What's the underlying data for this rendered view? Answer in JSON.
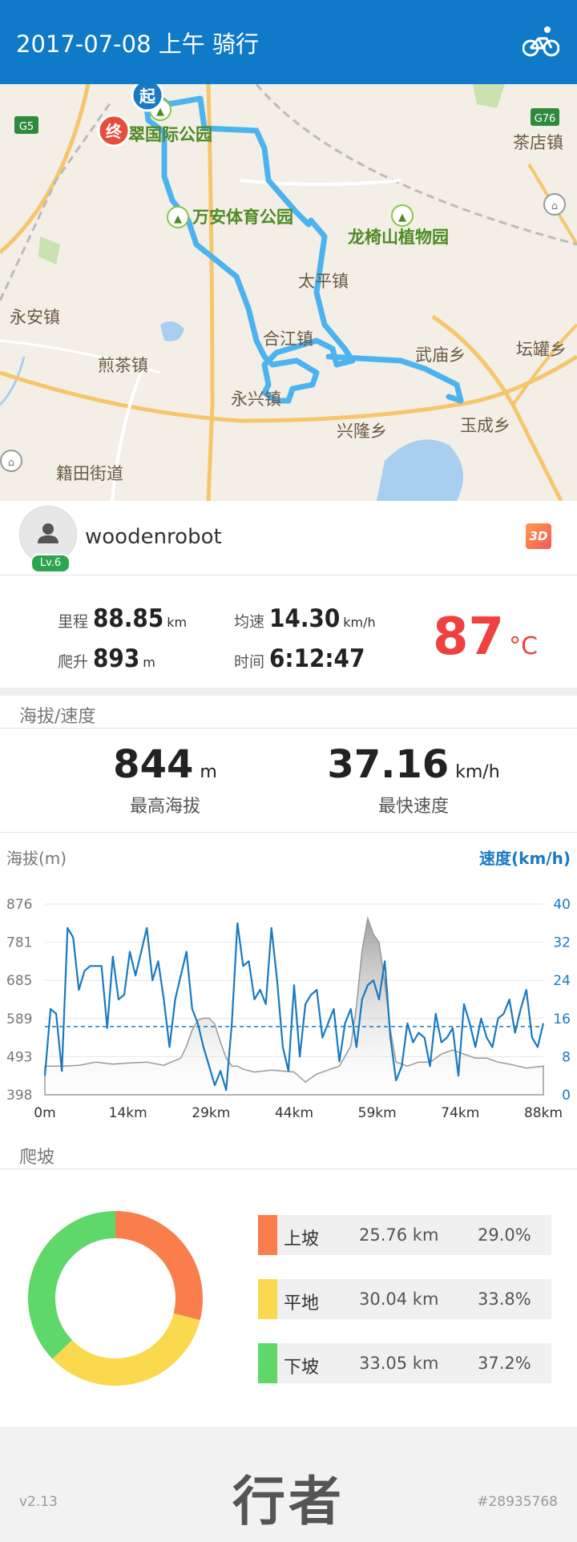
{
  "header": {
    "title": "2017-07-08 上午 骑行",
    "icon": "bicycle-icon"
  },
  "map": {
    "route_color": "#4bb3f0",
    "start_marker": "起",
    "end_marker": "终",
    "road_shields": [
      "G5",
      "G76"
    ],
    "labels": [
      {
        "id": "park1",
        "text": "翠国际公园",
        "style": "green"
      },
      {
        "id": "park2",
        "text": "万安体育公园",
        "style": "green"
      },
      {
        "id": "park3",
        "text": "龙椅山植物园",
        "style": "green"
      },
      {
        "id": "t1",
        "text": "茶店镇",
        "style": "town"
      },
      {
        "id": "t2",
        "text": "太平镇",
        "style": "town"
      },
      {
        "id": "t3",
        "text": "永安镇",
        "style": "town"
      },
      {
        "id": "t4",
        "text": "合江镇",
        "style": "town"
      },
      {
        "id": "t5",
        "text": "煎茶镇",
        "style": "town"
      },
      {
        "id": "t6",
        "text": "武庙乡",
        "style": "town"
      },
      {
        "id": "t7",
        "text": "坛罐乡",
        "style": "town"
      },
      {
        "id": "t8",
        "text": "永兴镇",
        "style": "town"
      },
      {
        "id": "t9",
        "text": "兴隆乡",
        "style": "town"
      },
      {
        "id": "t10",
        "text": "玉成乡",
        "style": "town"
      },
      {
        "id": "t11",
        "text": "籍田街道",
        "style": "town"
      }
    ]
  },
  "user": {
    "name": "woodenrobot",
    "level": "Lv.6",
    "badge_3d": "3D"
  },
  "stats": {
    "distance": {
      "label": "里程",
      "value": "88.85",
      "unit": "km"
    },
    "avg_speed": {
      "label": "均速",
      "value": "14.30",
      "unit": "km/h"
    },
    "climb": {
      "label": "爬升",
      "value": "893",
      "unit": "m"
    },
    "time": {
      "label": "时间",
      "value": "6:12:47"
    },
    "temperature": {
      "value": "87",
      "unit": "°C",
      "color": "#f04141"
    }
  },
  "altitude_speed": {
    "section_title": "海拔/速度",
    "max_altitude": {
      "value": "844",
      "unit": "m",
      "label": "最高海拔"
    },
    "max_speed": {
      "value": "37.16",
      "unit": "km/h",
      "label": "最快速度"
    }
  },
  "chart_data": {
    "type": "line",
    "left_axis_label": "海拔(m)",
    "right_axis_label": "速度(km/h)",
    "y_left_ticks": [
      "876",
      "781",
      "685",
      "589",
      "493",
      "398"
    ],
    "y_right_ticks": [
      "40",
      "32",
      "24",
      "16",
      "8",
      "0"
    ],
    "x_ticks": [
      "0m",
      "14km",
      "29km",
      "44km",
      "59km",
      "74km",
      "88km"
    ],
    "ylim_left": [
      398,
      876
    ],
    "ylim_right": [
      0,
      40
    ],
    "xlim": [
      0,
      88
    ],
    "avg_speed_line": 14.3,
    "series": [
      {
        "name": "海拔(m)",
        "color": "#999999",
        "x": [
          0,
          3,
          6,
          9,
          12,
          15,
          18,
          21,
          24,
          25,
          26,
          27,
          28,
          29,
          30,
          31,
          32,
          33,
          34,
          35,
          37,
          40,
          44,
          46,
          48,
          50,
          52,
          54,
          55,
          56,
          57,
          58,
          59,
          60,
          61,
          62,
          64,
          66,
          68,
          70,
          72,
          74,
          76,
          78,
          80,
          82,
          85,
          88
        ],
        "values": [
          470,
          470,
          472,
          480,
          475,
          478,
          480,
          472,
          490,
          520,
          560,
          585,
          590,
          590,
          575,
          530,
          490,
          470,
          470,
          462,
          455,
          460,
          455,
          430,
          450,
          460,
          470,
          520,
          620,
          760,
          840,
          800,
          780,
          680,
          560,
          480,
          470,
          480,
          480,
          500,
          510,
          500,
          490,
          490,
          480,
          475,
          465,
          470
        ]
      },
      {
        "name": "速度(km/h)",
        "color": "#1a79c0",
        "x": [
          0,
          1,
          2,
          3,
          4,
          5,
          6,
          7,
          8,
          9,
          10,
          11,
          12,
          13,
          14,
          15,
          16,
          17,
          18,
          19,
          20,
          21,
          22,
          23,
          24,
          25,
          26,
          27,
          28,
          29,
          30,
          31,
          32,
          33,
          34,
          35,
          36,
          37,
          38,
          39,
          40,
          41,
          42,
          43,
          44,
          45,
          46,
          47,
          48,
          49,
          50,
          51,
          52,
          53,
          54,
          55,
          56,
          57,
          58,
          59,
          60,
          61,
          62,
          63,
          64,
          65,
          66,
          67,
          68,
          69,
          70,
          71,
          72,
          73,
          74,
          75,
          76,
          77,
          78,
          79,
          80,
          81,
          82,
          83,
          84,
          85,
          86,
          87,
          88
        ],
        "values": [
          4,
          18,
          17,
          5,
          35,
          33,
          22,
          26,
          27,
          27,
          27,
          14,
          29,
          20,
          21,
          30,
          25,
          30,
          35,
          24,
          28,
          20,
          10,
          20,
          25,
          30,
          18,
          15,
          10,
          6,
          2,
          5,
          1,
          15,
          36,
          27,
          28,
          20,
          22,
          19,
          35,
          24,
          10,
          5,
          23,
          8,
          19,
          21,
          22,
          12,
          15,
          18,
          7,
          15,
          18,
          10,
          20,
          23,
          24,
          20,
          28,
          12,
          3,
          6,
          15,
          11,
          13,
          12,
          6,
          17,
          11,
          12,
          14,
          4,
          19,
          15,
          10,
          16,
          12,
          10,
          16,
          17,
          20,
          13,
          18,
          22,
          12,
          10,
          15
        ]
      }
    ]
  },
  "climb_section": {
    "title": "爬坡",
    "rows": [
      {
        "label": "上坡",
        "km": "25.76 km",
        "pct": "29.0%",
        "fraction": 0.29,
        "color": "#f97e4c"
      },
      {
        "label": "平地",
        "km": "30.04 km",
        "pct": "33.8%",
        "fraction": 0.338,
        "color": "#fbd94f"
      },
      {
        "label": "下坡",
        "km": "33.05 km",
        "pct": "37.2%",
        "fraction": 0.372,
        "color": "#5fd86a"
      }
    ]
  },
  "footer": {
    "version": "v2.13",
    "brand": "行者",
    "record_id": "#28935768"
  }
}
